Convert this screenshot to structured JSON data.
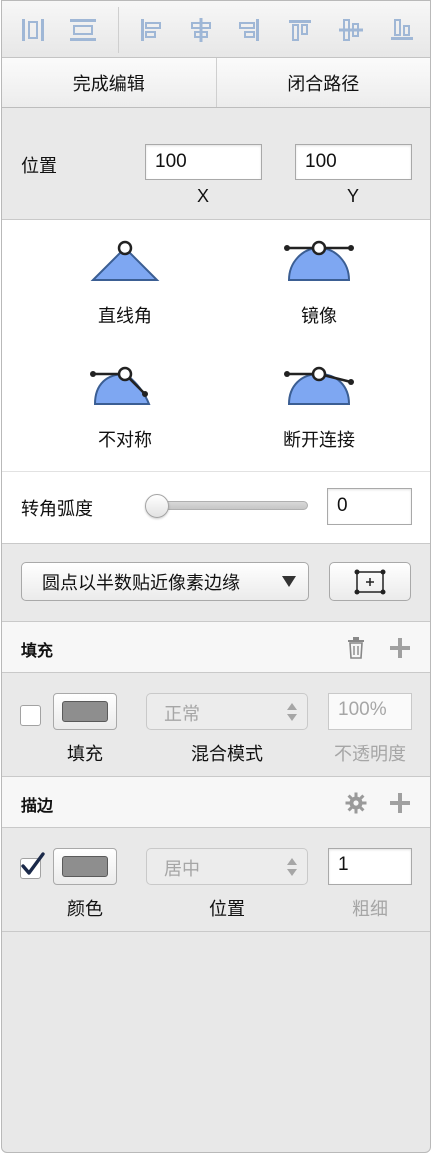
{
  "toolbar": {
    "buttons": [
      {
        "name": "distribute-horizontal-icon"
      },
      {
        "name": "distribute-vertical-icon"
      },
      {
        "name": "align-left-icon"
      },
      {
        "name": "align-center-horizontal-icon"
      },
      {
        "name": "align-right-icon"
      },
      {
        "name": "align-top-icon"
      },
      {
        "name": "align-middle-vertical-icon"
      },
      {
        "name": "align-bottom-icon"
      }
    ],
    "icon_color": "#9fb7d6"
  },
  "edit_row": {
    "finish_editing": "完成编辑",
    "close_path": "闭合路径"
  },
  "position": {
    "label": "位置",
    "x_value": "100",
    "y_value": "100",
    "x_label": "X",
    "y_label": "Y"
  },
  "corner_types": {
    "straight": "直线角",
    "mirrored": "镜像",
    "asymmetric": "不对称",
    "disconnected": "断开连接",
    "fill_color": "#7ea7f2"
  },
  "radius": {
    "label": "转角弧度",
    "slider_value": 0,
    "value": "0"
  },
  "pixel": {
    "dropdown_value": "圆点以半数贴近像素边缘"
  },
  "fill": {
    "title": "填充",
    "enabled": false,
    "swatch_color": "#8e8e8e",
    "blend_mode": "正常",
    "opacity": "100%",
    "caption_fill": "填充",
    "caption_blend": "混合模式",
    "caption_opacity": "不透明度"
  },
  "border": {
    "title": "描边",
    "enabled": true,
    "swatch_color": "#8e8e8e",
    "position_value": "居中",
    "thickness": "1",
    "caption_color": "颜色",
    "caption_position": "位置",
    "caption_thickness": "粗细"
  }
}
